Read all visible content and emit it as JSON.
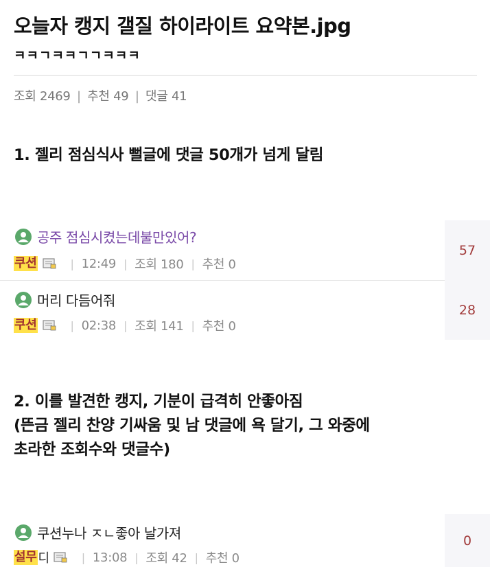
{
  "post": {
    "title": "오늘자 캥지 갤질 하이라이트 요약본.jpg",
    "title_laugh": "ㅋㅋㄱㅋㅋㄱㄱㅋㅋㅋ",
    "stats": {
      "views_label": "조회 2469",
      "recommend_label": "추천 49",
      "comments_label": "댓글 41",
      "separator": "|"
    }
  },
  "sections": [
    {
      "text": "1. 젤리 점심식사 뻘글에 댓글 50개가 넘게 달림"
    },
    {
      "text": "2. 이를 발견한 캥지, 기분이 급격히 안좋아짐\n(뜬금 젤리 찬양 기싸움 및 남 댓글에 욕 달기, 그 와중에\n초라한 조회수와 댓글수)"
    }
  ],
  "posts": [
    {
      "title": "공주 점심시켰는데불만있어?",
      "title_color": "#7a4aa8",
      "nick": "쿠션",
      "nick_extra": "",
      "time": "12:49",
      "views": "조회 180",
      "recommend": "추천 0",
      "comment_count": "57"
    },
    {
      "title": "머리 다듬어줘",
      "title_color": "#222222",
      "nick": "쿠션",
      "nick_extra": "",
      "time": "02:38",
      "views": "조회 141",
      "recommend": "추천 0",
      "comment_count": "28"
    },
    {
      "title": "쿠션누나 ㅈㄴ좋아 날가져",
      "title_color": "#222222",
      "nick": "설무",
      "nick_extra": "디",
      "time": "13:08",
      "views": "조회 42",
      "recommend": "추천 0",
      "comment_count": "0"
    }
  ],
  "icons": {
    "avatar": "user-avatar-icon",
    "memo": "memo-icon"
  },
  "colors": {
    "nick_highlight": "#ffe14a",
    "nick_text": "#a03030",
    "count_text": "#a23b3b",
    "avatar_green": "#5aa86a"
  }
}
